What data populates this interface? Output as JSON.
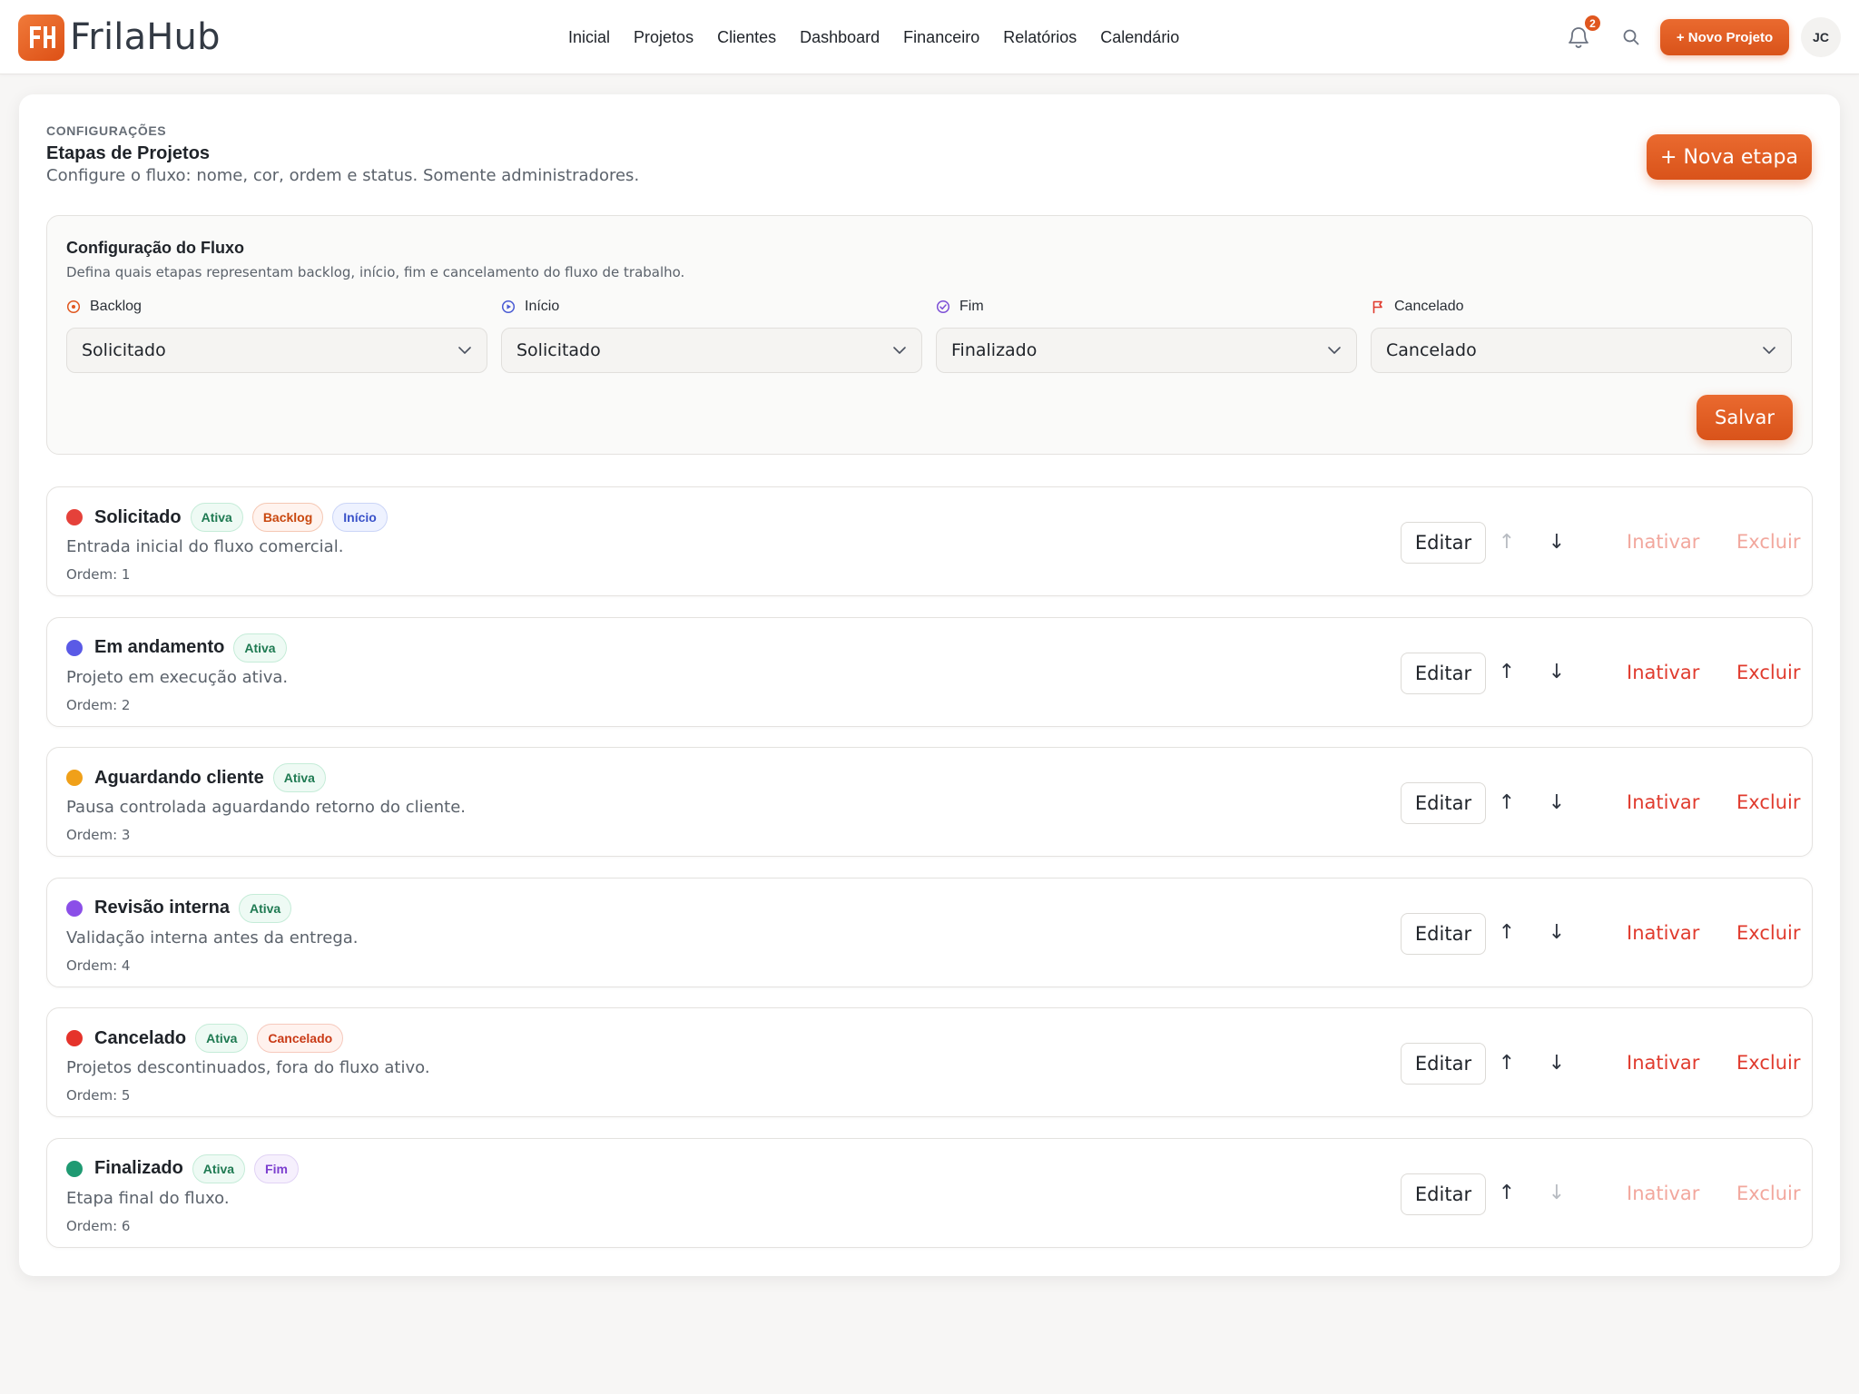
{
  "header": {
    "brand": "FrilaHub",
    "nav": [
      "Inicial",
      "Projetos",
      "Clientes",
      "Dashboard",
      "Financeiro",
      "Relatórios",
      "Calendário"
    ],
    "notifications_count": "2",
    "new_project_label": "+ Novo Projeto",
    "avatar_initials": "JC"
  },
  "page": {
    "eyebrow": "CONFIGURAÇÕES",
    "title": "Etapas de Projetos",
    "description": "Configure o fluxo: nome, cor, ordem e status. Somente administradores.",
    "new_stage_label": "+ Nova etapa"
  },
  "flow": {
    "title": "Configuração do Fluxo",
    "description": "Defina quais etapas representam backlog, início, fim e cancelamento do fluxo de trabalho.",
    "fields": [
      {
        "label": "Backlog",
        "value": "Solicitado",
        "icon": "target-icon",
        "color": "#e0571f"
      },
      {
        "label": "Início",
        "value": "Solicitado",
        "icon": "play-circle-icon",
        "color": "#4a5bd4"
      },
      {
        "label": "Fim",
        "value": "Finalizado",
        "icon": "check-circle-icon",
        "color": "#7c4fd6"
      },
      {
        "label": "Cancelado",
        "value": "Cancelado",
        "icon": "flag-icon",
        "color": "#e03b2e"
      }
    ],
    "save_label": "Salvar"
  },
  "actions": {
    "edit": "Editar",
    "up": "↑",
    "down": "↓",
    "deactivate": "Inativar",
    "delete": "Excluir"
  },
  "stages": [
    {
      "name": "Solicitado",
      "color": "#e5413a",
      "badges": [
        "Ativa",
        "Backlog",
        "Início"
      ],
      "description": "Entrada inicial do fluxo comercial.",
      "order": "Ordem: 1",
      "up_disabled": true,
      "down_disabled": false,
      "actions_disabled": true
    },
    {
      "name": "Em andamento",
      "color": "#5a5ae6",
      "badges": [
        "Ativa"
      ],
      "description": "Projeto em execução ativa.",
      "order": "Ordem: 2",
      "up_disabled": false,
      "down_disabled": false,
      "actions_disabled": false
    },
    {
      "name": "Aguardando cliente",
      "color": "#f0a019",
      "badges": [
        "Ativa"
      ],
      "description": "Pausa controlada aguardando retorno do cliente.",
      "order": "Ordem: 3",
      "up_disabled": false,
      "down_disabled": false,
      "actions_disabled": false
    },
    {
      "name": "Revisão interna",
      "color": "#8b4fe8",
      "badges": [
        "Ativa"
      ],
      "description": "Validação interna antes da entrega.",
      "order": "Ordem: 4",
      "up_disabled": false,
      "down_disabled": false,
      "actions_disabled": false
    },
    {
      "name": "Cancelado",
      "color": "#e5332b",
      "badges": [
        "Ativa",
        "Cancelado"
      ],
      "description": "Projetos descontinuados, fora do fluxo ativo.",
      "order": "Ordem: 5",
      "up_disabled": false,
      "down_disabled": false,
      "actions_disabled": false
    },
    {
      "name": "Finalizado",
      "color": "#1f9a72",
      "badges": [
        "Ativa",
        "Fim"
      ],
      "description": "Etapa final do fluxo.",
      "order": "Ordem: 6",
      "up_disabled": false,
      "down_disabled": true,
      "actions_disabled": true
    }
  ],
  "theme": {
    "accent": "#e0571f"
  }
}
